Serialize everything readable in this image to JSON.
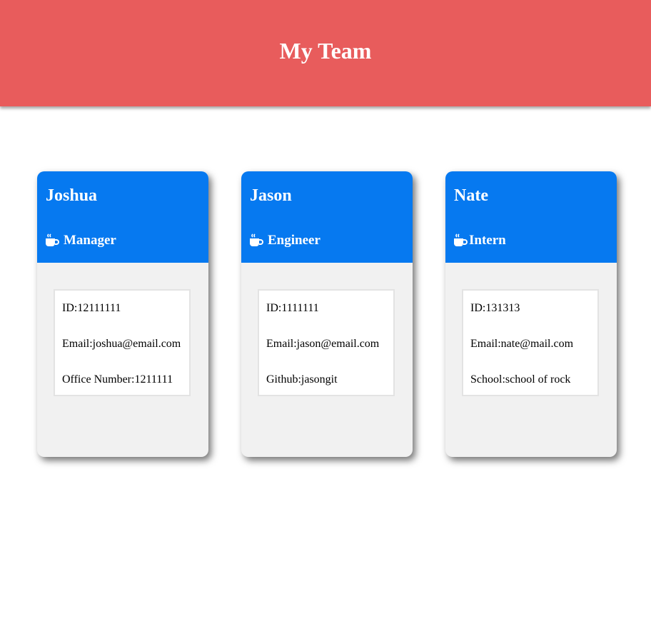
{
  "page": {
    "title": "My Team"
  },
  "colors": {
    "header": "#e85c5c",
    "card_header": "#0679f0",
    "card_body": "#f1f1f1"
  },
  "employees": [
    {
      "name": "Joshua",
      "role_icon": "coffee-mug-icon",
      "role": "Manager",
      "id_text": "ID:12111111",
      "email_text": "Email:joshua@email.com",
      "extra_text": "Office Number:1211111"
    },
    {
      "name": "Jason",
      "role_icon": "coffee-mug-icon",
      "role": "Engineer",
      "id_text": "ID:1111111",
      "email_text": "Email:jason@email.com",
      "extra_text": "Github:jasongit"
    },
    {
      "name": "Nate",
      "role_icon": "coffee-mug-icon",
      "role": "Intern",
      "id_text": "ID:131313",
      "email_text": "Email:nate@mail.com",
      "extra_text": "School:school of rock"
    }
  ]
}
